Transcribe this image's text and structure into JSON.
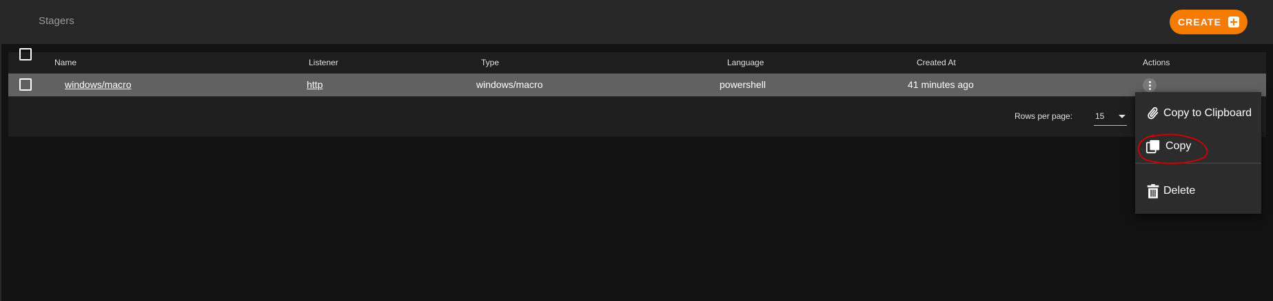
{
  "header": {
    "title": "Stagers",
    "create_label": "CREATE"
  },
  "table": {
    "columns": [
      "Name",
      "Listener",
      "Type",
      "Language",
      "Created At",
      "Actions"
    ],
    "rows": [
      {
        "name": "windows/macro",
        "listener": "http",
        "type": "windows/macro",
        "language": "powershell",
        "created_at": "41 minutes ago"
      }
    ]
  },
  "pagination": {
    "rows_per_page_label": "Rows per page:",
    "rows_per_page_value": "15"
  },
  "context_menu": {
    "items": [
      {
        "label": "Copy to Clipboard",
        "icon": "paperclip-icon"
      },
      {
        "label": "Copy",
        "icon": "copy-icon"
      },
      {
        "label": "Delete",
        "icon": "trash-icon"
      }
    ]
  },
  "colors": {
    "accent": "#f57c00",
    "annotation": "#cc0000",
    "background": "#121212",
    "selected_row": "#616161"
  }
}
